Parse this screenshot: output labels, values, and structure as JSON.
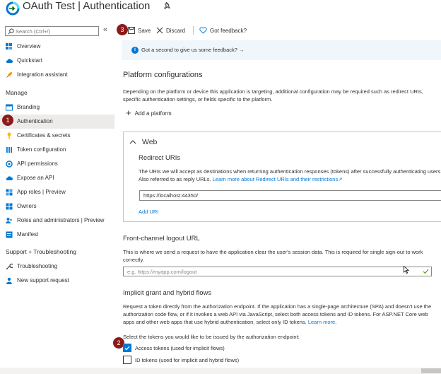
{
  "header": {
    "title": "OAuth Test | Authentication"
  },
  "sidebar": {
    "search_placeholder": "Search (Ctrl+/)",
    "collapse_glyph": "«",
    "top_items": [
      {
        "label": "Overview",
        "icon": "grid-icon"
      },
      {
        "label": "Quickstart",
        "icon": "cloud-icon"
      },
      {
        "label": "Integration assistant",
        "icon": "rocket-icon"
      }
    ],
    "manage_heading": "Manage",
    "manage_items": [
      {
        "label": "Branding",
        "icon": "branding-icon"
      },
      {
        "label": "Authentication",
        "icon": "authentication-icon",
        "active": true
      },
      {
        "label": "Certificates & secrets",
        "icon": "key-icon"
      },
      {
        "label": "Token configuration",
        "icon": "token-icon"
      },
      {
        "label": "API permissions",
        "icon": "api-permissions-icon"
      },
      {
        "label": "Expose an API",
        "icon": "cloud-icon"
      },
      {
        "label": "App roles | Preview",
        "icon": "app-roles-icon"
      },
      {
        "label": "Owners",
        "icon": "owners-icon"
      },
      {
        "label": "Roles and administrators | Preview",
        "icon": "roles-icon"
      },
      {
        "label": "Manifest",
        "icon": "manifest-icon"
      }
    ],
    "support_heading": "Support + Troubleshooting",
    "support_items": [
      {
        "label": "Troubleshooting",
        "icon": "wrench-icon"
      },
      {
        "label": "New support request",
        "icon": "person-icon"
      }
    ]
  },
  "toolbar": {
    "save_label": "Save",
    "discard_label": "Discard",
    "feedback_label": "Got feedback?"
  },
  "info_bar": {
    "text": "Got a second to give us some feedback? →"
  },
  "platform": {
    "heading": "Platform configurations",
    "description": "Depending on the platform or device this application is targeting, additional configuration may be required such as redirect URIs, specific authentication settings, or fields specific to the platform.",
    "add_label": "Add a platform"
  },
  "web": {
    "title": "Web",
    "redirect_heading": "Redirect URIs",
    "redirect_desc": "The URIs we will accept as destinations when returning authentication responses (tokens) after successfully authenticating users. Also referred to as reply URLs.",
    "redirect_link": "Learn more about Redirect URIs and their restrictions",
    "redirect_value": "https://localhost:44350/",
    "add_uri_label": "Add URI"
  },
  "logout": {
    "heading": "Front-channel logout URL",
    "description": "This is where we send a request to have the application clear the user's session data. This is required for single sign-out to work correctly.",
    "placeholder": "e.g. https://myapp.com/logout"
  },
  "implicit": {
    "heading": "Implicit grant and hybrid flows",
    "description": "Request a token directly from the authorization endpoint. If the application has a single-page architecture (SPA) and doesn't use the authorization code flow, or if it invokes a web API via JavaScript, select both access tokens and ID tokens. For ASP.NET Core web apps and other web apps that use hybrid authentication, select only ID tokens.",
    "learn_more": "Learn more.",
    "select_prompt": "Select the tokens you would like to be issued by the authorization endpoint:",
    "access_tokens_label": "Access tokens (used for implicit flows)",
    "access_tokens_checked": true,
    "id_tokens_label": "ID tokens (used for implicit and hybrid flows)",
    "id_tokens_checked": false
  },
  "annotations": {
    "badge_1": "1",
    "badge_2": "2",
    "badge_3": "3"
  },
  "colors": {
    "accent": "#0078d4",
    "badge": "#8b1a1a",
    "active_nav": "#edebe9",
    "info_bar": "#eff6fc"
  }
}
